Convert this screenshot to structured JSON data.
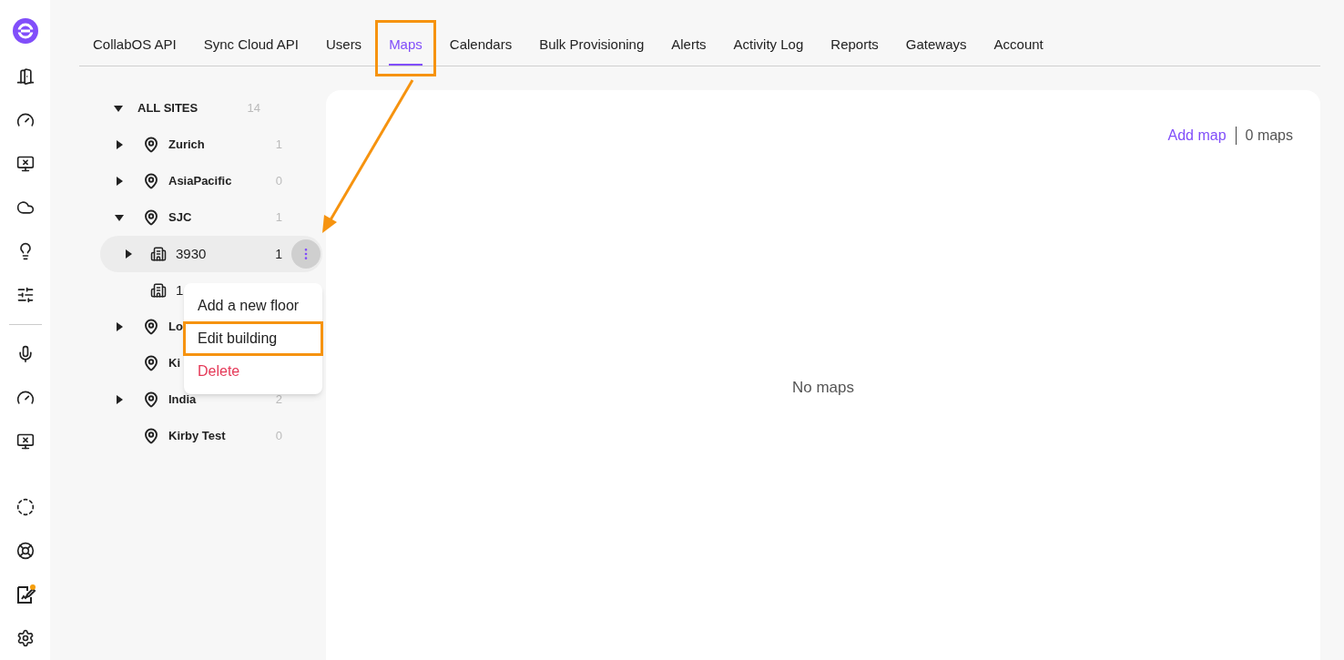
{
  "tabs": [
    {
      "label": "CollabOS API",
      "selected": false,
      "highlighted": false
    },
    {
      "label": "Sync Cloud API",
      "selected": false,
      "highlighted": false
    },
    {
      "label": "Users",
      "selected": false,
      "highlighted": false
    },
    {
      "label": "Maps",
      "selected": true,
      "highlighted": true
    },
    {
      "label": "Calendars",
      "selected": false,
      "highlighted": false
    },
    {
      "label": "Bulk Provisioning",
      "selected": false,
      "highlighted": false
    },
    {
      "label": "Alerts",
      "selected": false,
      "highlighted": false
    },
    {
      "label": "Activity Log",
      "selected": false,
      "highlighted": false
    },
    {
      "label": "Reports",
      "selected": false,
      "highlighted": false
    },
    {
      "label": "Gateways",
      "selected": false,
      "highlighted": false
    },
    {
      "label": "Account",
      "selected": false,
      "highlighted": false
    }
  ],
  "tree": {
    "label": "ALL SITES",
    "count": "14",
    "expanded": true,
    "children": [
      {
        "kind": "site",
        "label": "Zurich",
        "count": "1",
        "expanded": false,
        "selected": false
      },
      {
        "kind": "site",
        "label": "AsiaPacific",
        "count": "0",
        "expanded": false,
        "selected": false
      },
      {
        "kind": "site",
        "label": "SJC",
        "count": "1",
        "expanded": true,
        "selected": false,
        "children": [
          {
            "kind": "building",
            "label": "3930",
            "count": "1",
            "expanded": false,
            "selected": true
          },
          {
            "kind": "building",
            "label": "1",
            "selected": false
          }
        ]
      },
      {
        "kind": "site",
        "label": "Lo",
        "expanded": false,
        "selected": false
      },
      {
        "kind": "site",
        "label": "Ki",
        "selected": false
      },
      {
        "kind": "site",
        "label": "India",
        "count": "2",
        "expanded": false,
        "selected": false
      },
      {
        "kind": "site",
        "label": "Kirby Test",
        "count": "0",
        "selected": false
      }
    ]
  },
  "context_menu": [
    {
      "label": "Add a new floor",
      "kind": "normal",
      "highlighted": false
    },
    {
      "label": "Edit building",
      "kind": "normal",
      "highlighted": true
    },
    {
      "label": "Delete",
      "kind": "danger",
      "highlighted": false
    }
  ],
  "maps_panel": {
    "add_link": "Add map",
    "count": "0 maps",
    "empty_text": "No maps"
  }
}
